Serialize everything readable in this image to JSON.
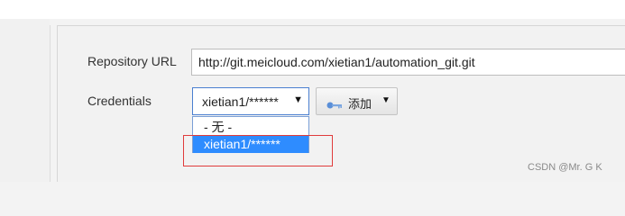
{
  "form": {
    "repository_url_label": "Repository URL",
    "repository_url_value": "http://git.meicloud.com/xietian1/automation_git.git",
    "credentials_label": "Credentials",
    "credentials_selected": "xietian1/******",
    "add_button_label": "添加",
    "dropdown_options": [
      "- 无 -",
      "xietian1/******"
    ],
    "dropdown_highlighted_index": 1
  },
  "watermark": "CSDN @Mr. G K",
  "colors": {
    "highlight_option": "#2e8cff",
    "annotation_box": "#e03c3c",
    "focus_border": "#4a7fd0"
  },
  "icons": {
    "select_arrow": "triangle-down-icon",
    "add_button_icon": "key-icon",
    "add_button_caret": "caret-down-icon"
  }
}
